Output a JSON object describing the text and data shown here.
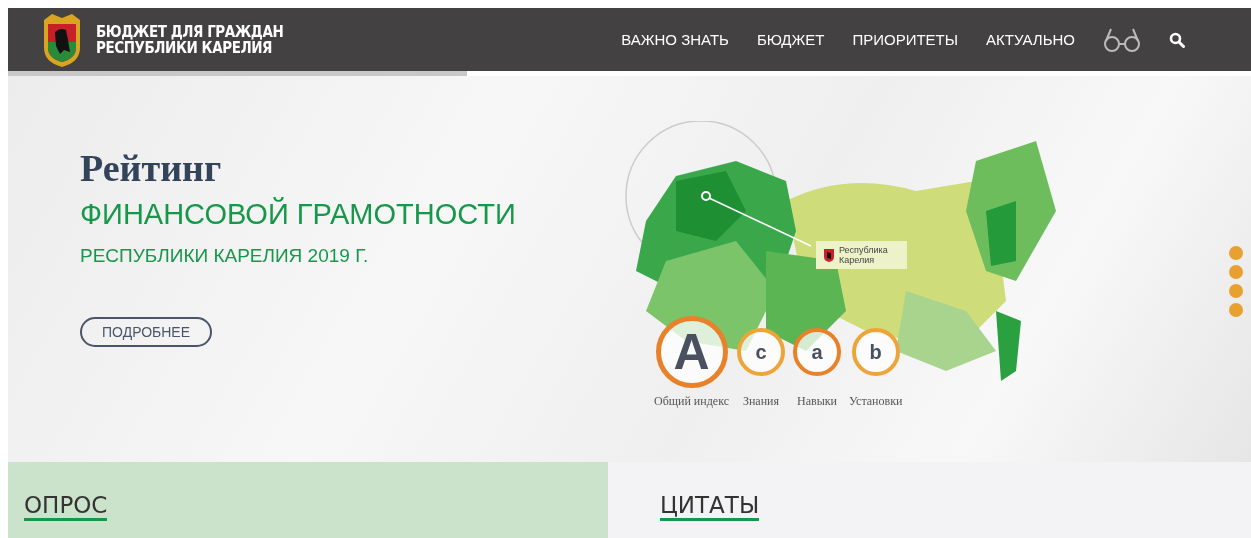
{
  "header": {
    "logo_lines": [
      "БЮДЖЕТ ДЛЯ ГРАЖДАН",
      "РЕСПУБЛИКИ КАРЕЛИЯ"
    ],
    "nav": [
      {
        "label": "ВАЖНО ЗНАТЬ"
      },
      {
        "label": "БЮДЖЕТ"
      },
      {
        "label": "ПРИОРИТЕТЫ"
      },
      {
        "label": "АКТУАЛЬНО"
      }
    ]
  },
  "hero": {
    "title": "Рейтинг",
    "subtitle": "ФИНАНСОВОЙ ГРАМОТНОСТИ",
    "subtitle_2": "РЕСПУБЛИКИ КАРЕЛИЯ 2019 Г.",
    "button": "ПОДРОБНЕЕ",
    "callout": "Республика Карелия",
    "grades": [
      {
        "letter": "A",
        "label": "Общий индекс",
        "kind": "large",
        "color": "#e8822a"
      },
      {
        "letter": "c",
        "label": "Знания",
        "kind": "small",
        "color": "#eda53a"
      },
      {
        "letter": "a",
        "label": "Навыки",
        "kind": "small",
        "color": "#e8822a"
      },
      {
        "letter": "b",
        "label": "Установки",
        "kind": "small",
        "color": "#eda53a"
      }
    ],
    "pager": [
      {
        "selected": false
      },
      {
        "selected": false
      },
      {
        "selected": false
      },
      {
        "selected": false
      }
    ]
  },
  "sections": [
    {
      "title": "ОПРОС",
      "kind": "green"
    },
    {
      "title": "ЦИТАТЫ",
      "kind": "grey"
    }
  ]
}
